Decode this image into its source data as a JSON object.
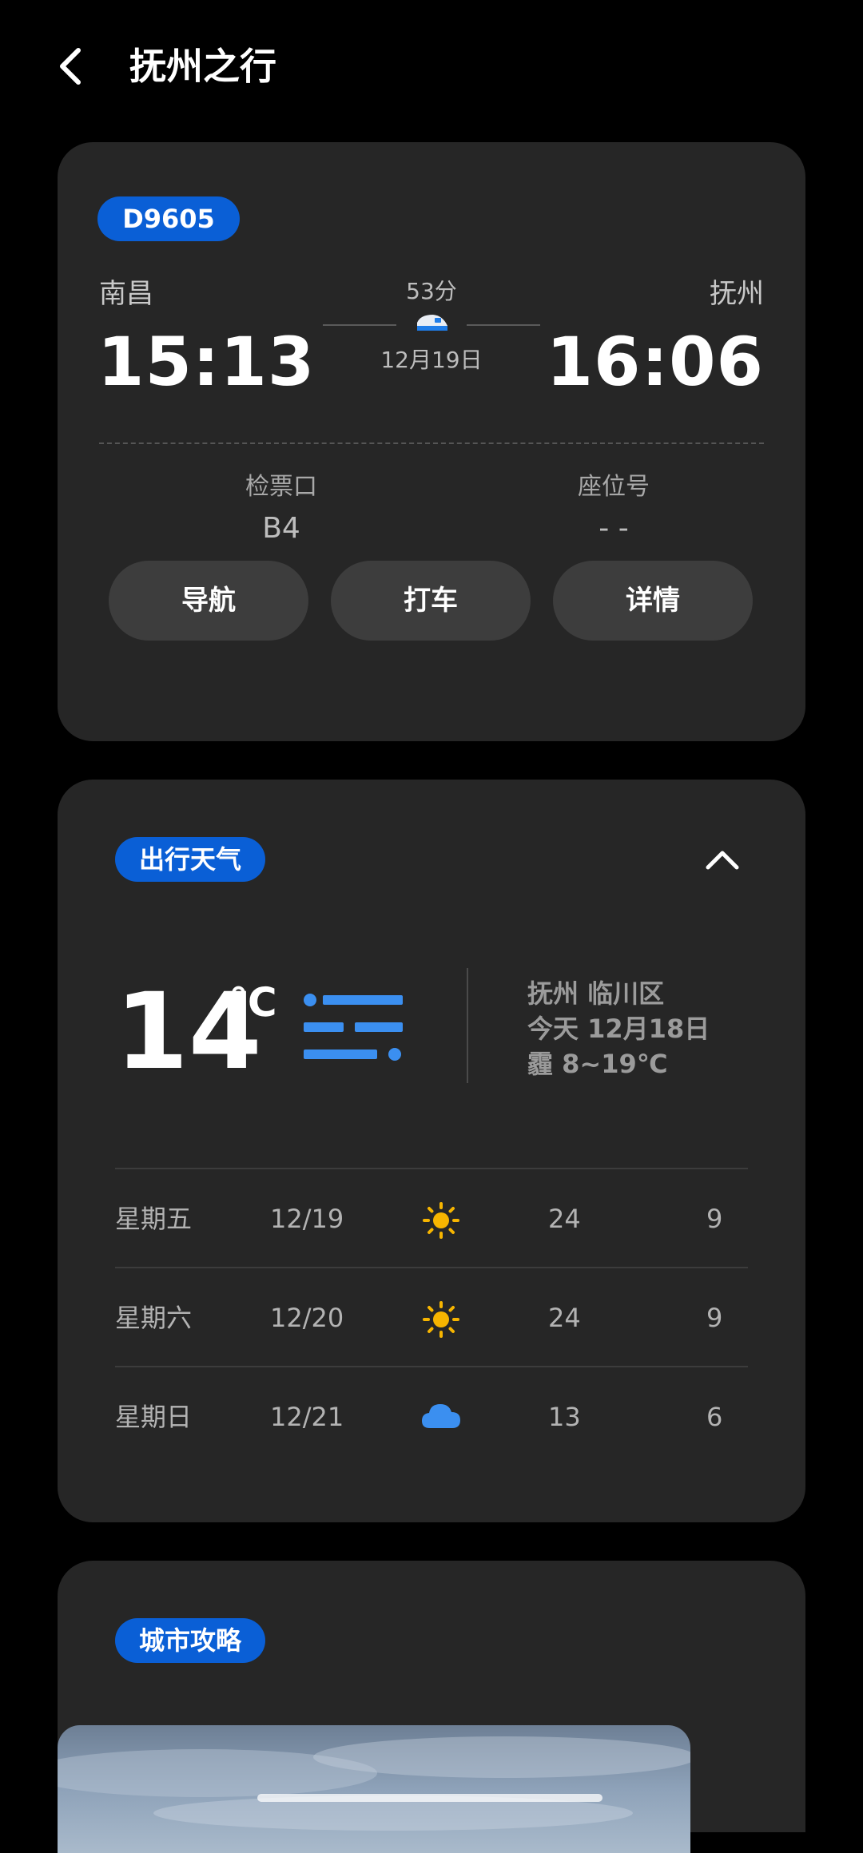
{
  "header": {
    "title": "抚州之行"
  },
  "train": {
    "number": "D9605",
    "from_station": "南昌",
    "to_station": "抚州",
    "depart_time": "15:13",
    "arrive_time": "16:06",
    "duration": "53分",
    "date": "12月19日",
    "gate_label": "检票口",
    "gate_value": "B4",
    "seat_label": "座位号",
    "seat_value": "- -",
    "buttons": {
      "navigate": "导航",
      "taxi": "打车",
      "details": "详情"
    },
    "accent_color": "#0a5fd6"
  },
  "weather": {
    "badge": "出行天气",
    "current_temp": "14",
    "unit": "℃",
    "current_icon": "haze-icon",
    "location": "抚州 临川区",
    "today": "今天 12月18日",
    "today_summary": "霾 8~19℃",
    "forecast": [
      {
        "day": "星期五",
        "date": "12/19",
        "icon": "sun-icon",
        "high": "24",
        "low": "9"
      },
      {
        "day": "星期六",
        "date": "12/20",
        "icon": "sun-icon",
        "high": "24",
        "low": "9"
      },
      {
        "day": "星期日",
        "date": "12/21",
        "icon": "cloud-icon",
        "high": "13",
        "low": "6"
      }
    ]
  },
  "city_guide": {
    "badge": "城市攻略"
  }
}
